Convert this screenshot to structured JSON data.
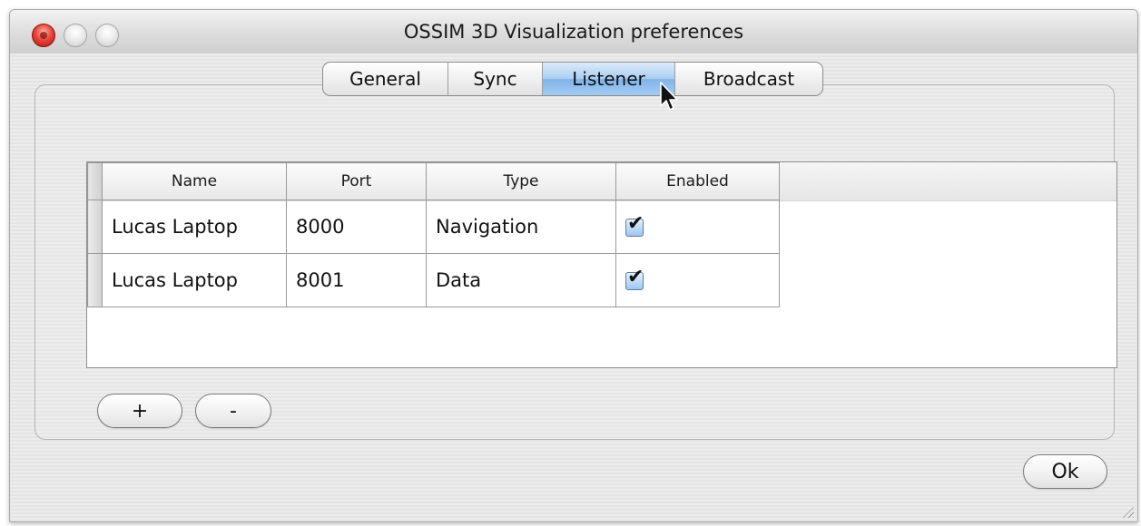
{
  "window": {
    "title": "OSSIM 3D Visualization preferences"
  },
  "tabs": [
    {
      "label": "General",
      "selected": false
    },
    {
      "label": "Sync",
      "selected": false
    },
    {
      "label": "Listener",
      "selected": true
    },
    {
      "label": "Broadcast",
      "selected": false
    }
  ],
  "table": {
    "columns": [
      "Name",
      "Port",
      "Type",
      "Enabled"
    ],
    "rows": [
      {
        "name": "Lucas Laptop",
        "port": "8000",
        "type": "Navigation",
        "enabled": true
      },
      {
        "name": "Lucas Laptop",
        "port": "8001",
        "type": "Data",
        "enabled": true
      }
    ]
  },
  "buttons": {
    "add_label": "+",
    "remove_label": "-",
    "ok_label": "Ok"
  },
  "icons": {
    "close": "close-icon",
    "minimize": "minimize-icon",
    "maximize": "zoom-icon",
    "cursor": "mouse-pointer-icon",
    "resize": "resize-grip-icon"
  },
  "colors": {
    "selected_tab": "#a9cdf2",
    "close_button": "#e8483a"
  }
}
